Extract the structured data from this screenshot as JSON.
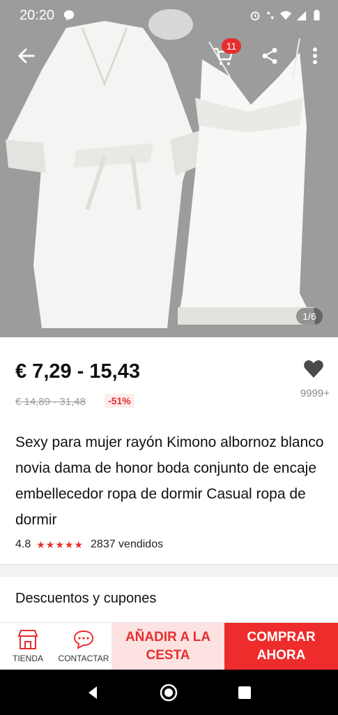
{
  "status_bar": {
    "time": "20:20",
    "icons": [
      "chat-bubble-icon",
      "alarm-icon",
      "data-arrows-icon",
      "wifi-icon",
      "signal-icon",
      "battery-icon"
    ]
  },
  "product_header": {
    "cart_badge": "11",
    "image_counter": "1/6",
    "icons": [
      "back-arrow-icon",
      "cart-icon",
      "share-icon",
      "more-vertical-icon"
    ]
  },
  "price": {
    "current": "€ 7,29 - 15,43",
    "original": "€ 14,89 - 31,48",
    "discount": "-51%",
    "wishlist_count": "9999+"
  },
  "product": {
    "title": "Sexy para mujer rayón Kimono albornoz blanco novia dama de honor boda conjunto de encaje embellecedor ropa de dormir Casual ropa de dormir",
    "rating": "4.8",
    "stars": "★★★★★",
    "sold": "2837 vendidos"
  },
  "sections": {
    "discounts_title": "Descuentos y cupones"
  },
  "actions": {
    "store_label": "TIENDA",
    "contact_label": "CONTACTAR",
    "add_to_cart_label": "AÑADIR A LA CESTA",
    "buy_now_label": "COMPRAR AHORA"
  },
  "colors": {
    "accent": "#e62e2e",
    "light_accent": "#fde2e2"
  }
}
